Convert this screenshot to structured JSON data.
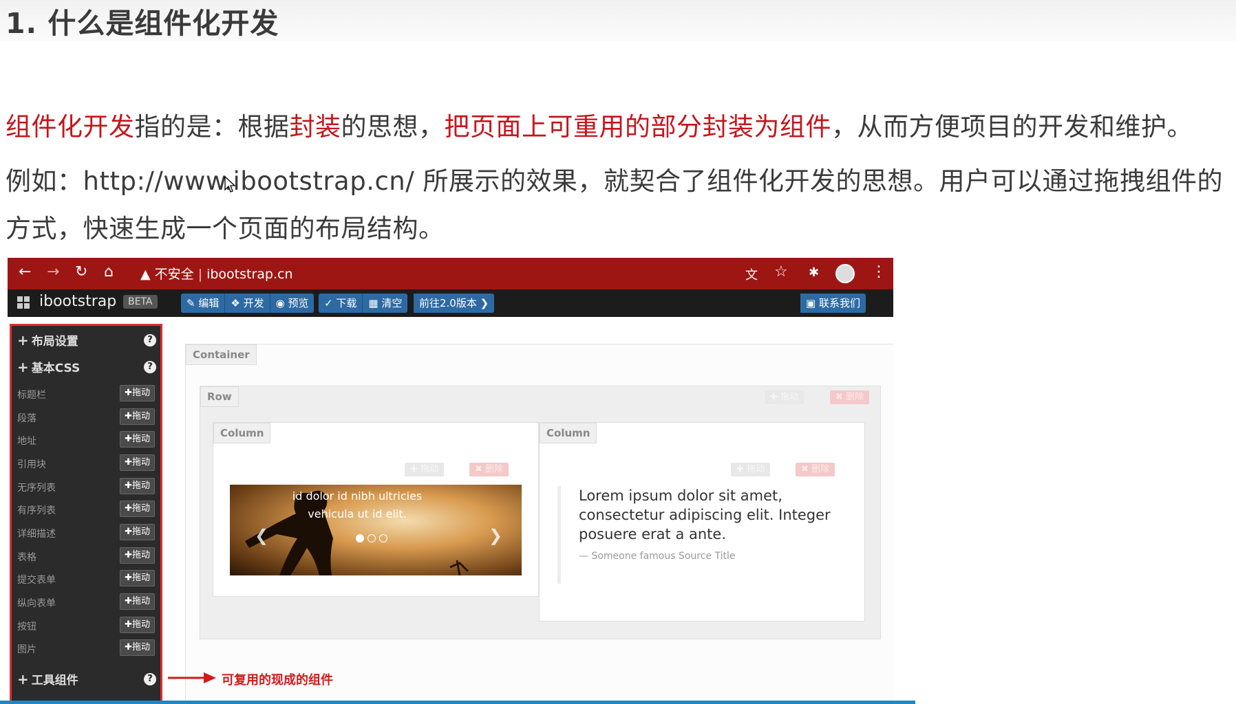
{
  "doc": {
    "title": "1. 什么是组件化开发",
    "p1": {
      "s1": "组件化开发",
      "s2": "指的是：根据",
      "s3": "封装",
      "s4": "的思想，",
      "s5": "把页面上可重用的部分封装为组件",
      "s6": "，从而方便项目的开发和维护。"
    },
    "p2": "例如：http://www.ibootstrap.cn/ 所展示的效果，就契合了组件化开发的思想。用户可以通过拖拽组件的",
    "p3": "方式，快速生成一个页面的布局结构。"
  },
  "browser": {
    "warning": "不安全",
    "url": "ibootstrap.cn"
  },
  "app": {
    "brand": "ibootstrap",
    "beta": "BETA",
    "toolbar1": [
      "编辑",
      "开发",
      "预览"
    ],
    "toolbar2": [
      "下载",
      "清空"
    ],
    "version": "前往2.0版本",
    "contact": "联系我们"
  },
  "sidebar": {
    "sections": [
      "布局设置",
      "基本CSS",
      "工具组件"
    ],
    "drag_label": "拖动",
    "help": "?",
    "items": [
      "标题栏",
      "段落",
      "地址",
      "引用块",
      "无序列表",
      "有序列表",
      "详细描述",
      "表格",
      "提交表单",
      "纵向表单",
      "按钮",
      "图片"
    ]
  },
  "canvas": {
    "container": "Container",
    "row": "Row",
    "column": "Column",
    "drag": "拖动",
    "delete": "删除",
    "carousel_caption": "id dolor id nibh ultricies vehicula ut id elit.",
    "quote_text": "Lorem ipsum dolor sit amet, consectetur adipiscing elit. Integer posuere erat a ante.",
    "quote_source": "— Someone famous Source Title"
  },
  "annotation": "可复用的现成的组件",
  "colors": {
    "highlight_red": "#c4161c",
    "chrome_red": "#9e1613",
    "nav_blue": "#2d6aa3",
    "sidebar_border": "#e03030"
  }
}
